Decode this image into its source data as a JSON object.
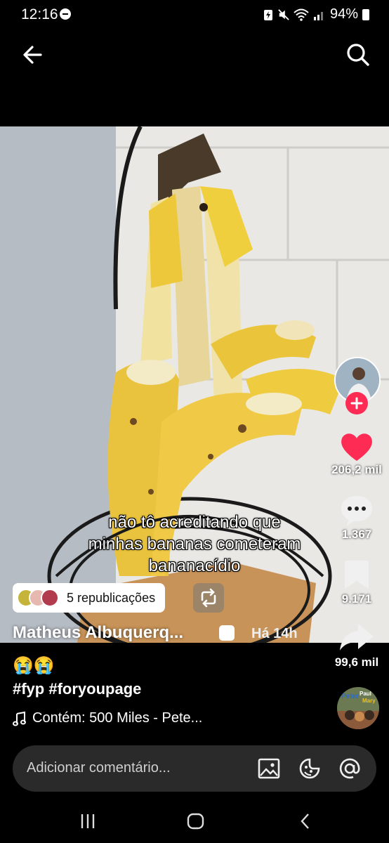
{
  "status_bar": {
    "time": "12:16",
    "battery": "94%"
  },
  "nav": {
    "back_icon": "arrow-left-icon",
    "search_icon": "search-icon"
  },
  "video": {
    "caption_lines": [
      "não tô acreditando que",
      "minhas bananas cometeram",
      "bananacídio"
    ],
    "reposts": "5 republicações",
    "author": "Matheus Albuquerq...",
    "time_ago": "Há 14h"
  },
  "rail": {
    "likes": "206,2 mil",
    "comments": "1.367",
    "saves": "9.171",
    "shares": "99,6 mil",
    "colors": {
      "like": "#fe2c55",
      "follow": "#fe2c55"
    }
  },
  "post": {
    "emoji": "😭😭",
    "hashtags": "#fyp #foryoupage",
    "music": "Contém: 500 Miles - Pete..."
  },
  "comment": {
    "placeholder": "Adicionar comentário..."
  },
  "disc_label": {
    "line1": "Peter",
    "line2": "Paul",
    "line3": "Mary"
  }
}
